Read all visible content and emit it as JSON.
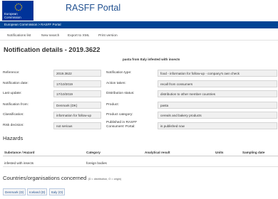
{
  "header": {
    "logo_text": [
      "European",
      "Commission"
    ],
    "portal_title": "RASFF Portal"
  },
  "breadcrumb": [
    "European Commission",
    "RASFF Portal"
  ],
  "breadcrumb_separator": ">",
  "toolbar": [
    "Notifications list",
    "New search",
    "Export to XML",
    "Print version"
  ],
  "page": {
    "title": "Notification details - 2019.3622",
    "subject": "pasta from Italy infested with insects"
  },
  "details_left": [
    {
      "label": "Reference:",
      "value": "2019.3622"
    },
    {
      "label": "Notification date:",
      "value": "17/10/2019"
    },
    {
      "label": "Last update:",
      "value": "17/10/2019"
    },
    {
      "label": "Notification from:",
      "value": "Denmark (DK)"
    },
    {
      "label": "Classification:",
      "value": "information for follow-up"
    },
    {
      "label": "Risk decision:",
      "value": "not serious"
    }
  ],
  "details_right": [
    {
      "label": "Notification type:",
      "value": "food - information for follow-up - company's own check"
    },
    {
      "label": "Action taken:",
      "value": "recall from consumers"
    },
    {
      "label": "Distribution status:",
      "value": "distribution to other member countries"
    },
    {
      "label": "Product:",
      "value": "pasta"
    },
    {
      "label": "Product category:",
      "value": "cereals and bakery products"
    },
    {
      "label": [
        "Published in RASFF",
        "Consumers' Portal:"
      ],
      "value": "is published now"
    }
  ],
  "hazards": {
    "title": "Hazards",
    "columns": [
      "Substance / Hazard",
      "Category",
      "Analytical result",
      "Units",
      "Sampling date"
    ],
    "rows": [
      [
        "infested with insects",
        "foreign bodies",
        "",
        "",
        ""
      ]
    ]
  },
  "countries": {
    "title": "Countries/organisations concerned",
    "note": "(D = distribution, O = origin)",
    "items": [
      "Denmark (D)",
      "Iceland (D)",
      "Italy (O)"
    ]
  },
  "colors": {
    "brand_blue": "#004494",
    "eu_flag_blue": "#003399",
    "eu_star_yellow": "#ffcc00",
    "title_blue": "#1f4f8f"
  }
}
